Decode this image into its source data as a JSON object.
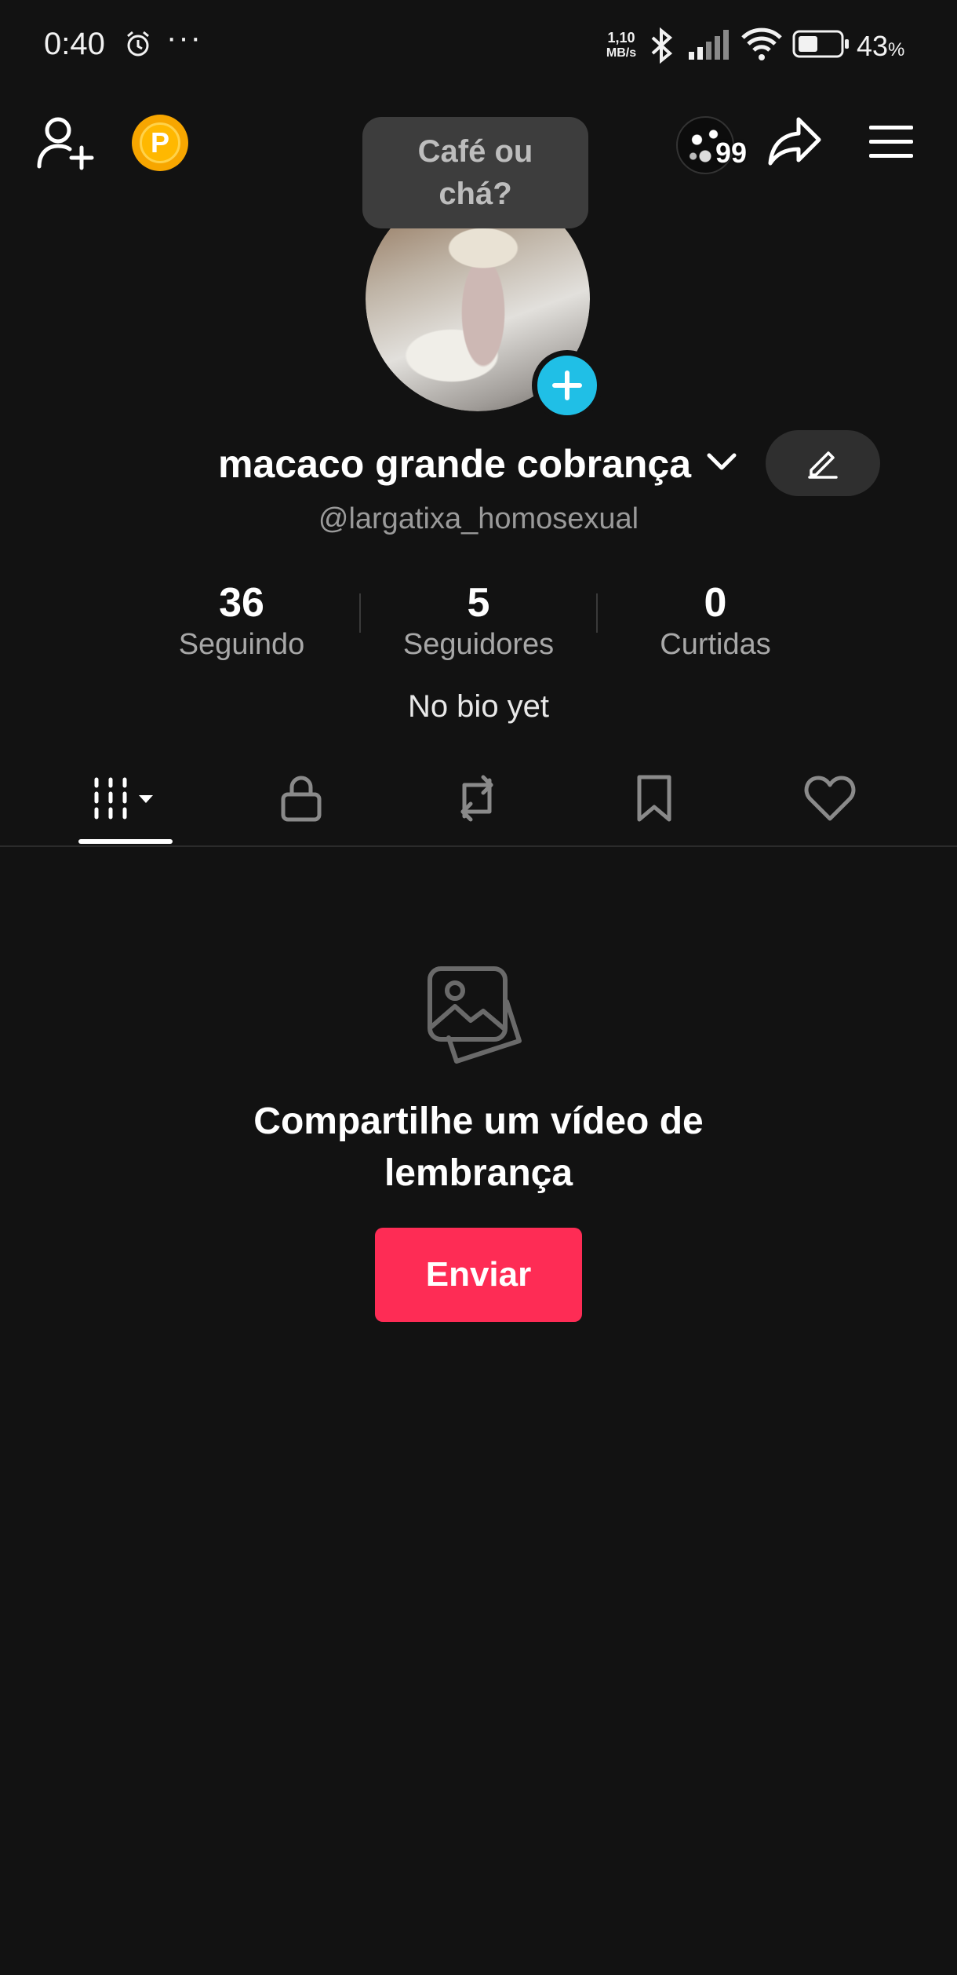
{
  "status_bar": {
    "time": "0:40",
    "more": "···",
    "net_speed_value": "1,10",
    "net_speed_unit": "MB/s",
    "battery_percent": "43",
    "percent_sign": "%"
  },
  "header": {
    "add_friend_icon": "person-add-icon",
    "coin_letter": "P",
    "tooltip": "Café ou chá?",
    "notification_count": "99",
    "share_icon": "share-icon",
    "menu_icon": "menu-icon"
  },
  "profile": {
    "display_name": "macaco grande cobrança",
    "username": "@largatixa_homosexual",
    "bio": "No bio yet",
    "stats": [
      {
        "value": "36",
        "label": "Seguindo"
      },
      {
        "value": "5",
        "label": "Seguidores"
      },
      {
        "value": "0",
        "label": "Curtidas"
      }
    ]
  },
  "tabs": [
    {
      "icon": "videos-grid-icon",
      "active": true
    },
    {
      "icon": "lock-icon",
      "active": false
    },
    {
      "icon": "repost-icon",
      "active": false
    },
    {
      "icon": "bookmark-icon",
      "active": false
    },
    {
      "icon": "heart-icon",
      "active": false
    }
  ],
  "empty_state": {
    "icon": "photos-icon",
    "title": "Compartilhe um vídeo de lembrança",
    "button_label": "Enviar"
  },
  "colors": {
    "background": "#121212",
    "accent": "#fe2c55",
    "plus_badge": "#20bfe6",
    "coin": "#f7a600"
  }
}
